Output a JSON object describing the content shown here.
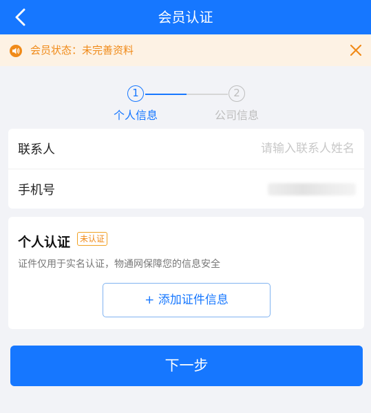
{
  "header": {
    "title": "会员认证",
    "back_icon": "chevron-left-icon"
  },
  "notice": {
    "text": "会员状态：未完善资料",
    "icon": "speaker-icon",
    "close_icon": "close-icon",
    "color": "#f08a18"
  },
  "steps": {
    "items": [
      {
        "number": "1",
        "label": "个人信息",
        "active": true
      },
      {
        "number": "2",
        "label": "公司信息",
        "active": false
      }
    ],
    "active_color": "#1677ff",
    "inactive_color": "#bdbdbd"
  },
  "form": {
    "contact": {
      "label": "联系人",
      "placeholder": "请输入联系人姓名",
      "value": ""
    },
    "phone": {
      "label": "手机号"
    }
  },
  "auth": {
    "title": "个人认证",
    "badge": "未认证",
    "desc": "证件仅用于实名认证，物通网保障您的信息安全",
    "add_button": "+ 添加证件信息"
  },
  "next_button": "下一步",
  "colors": {
    "primary": "#1677ff",
    "background": "#f2f3f7"
  }
}
